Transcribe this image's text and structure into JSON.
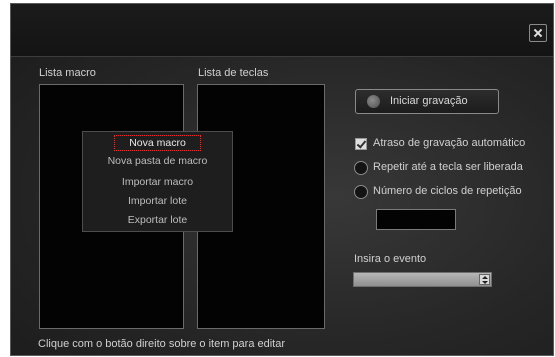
{
  "dialog": {
    "close_icon": "close-icon"
  },
  "macro_list": {
    "label": "Lista macro"
  },
  "key_list": {
    "label": "Lista de teclas"
  },
  "context_menu": {
    "items": [
      "Nova macro",
      "Nova pasta de macro",
      "Importar macro",
      "Importar lote",
      "Exportar lote"
    ],
    "selected_index": 0
  },
  "recording": {
    "start_label": "Iniciar gravação",
    "options": {
      "auto_delay_label": "Atraso de gravação automático",
      "auto_delay_checked": true,
      "repeat_until_release_label": "Repetir até a tecla ser liberada",
      "repeat_cycles_label": "Número de ciclos de repetição",
      "cycles_value": ""
    }
  },
  "event": {
    "label": "Insira o evento",
    "selected_value": ""
  },
  "footer": {
    "hint": "Clique com o botão direito sobre o item para editar"
  },
  "colors": {
    "background": "#262626",
    "panel": "#030303",
    "text": "#d0d0d0",
    "focus_outline": "#e03030"
  }
}
